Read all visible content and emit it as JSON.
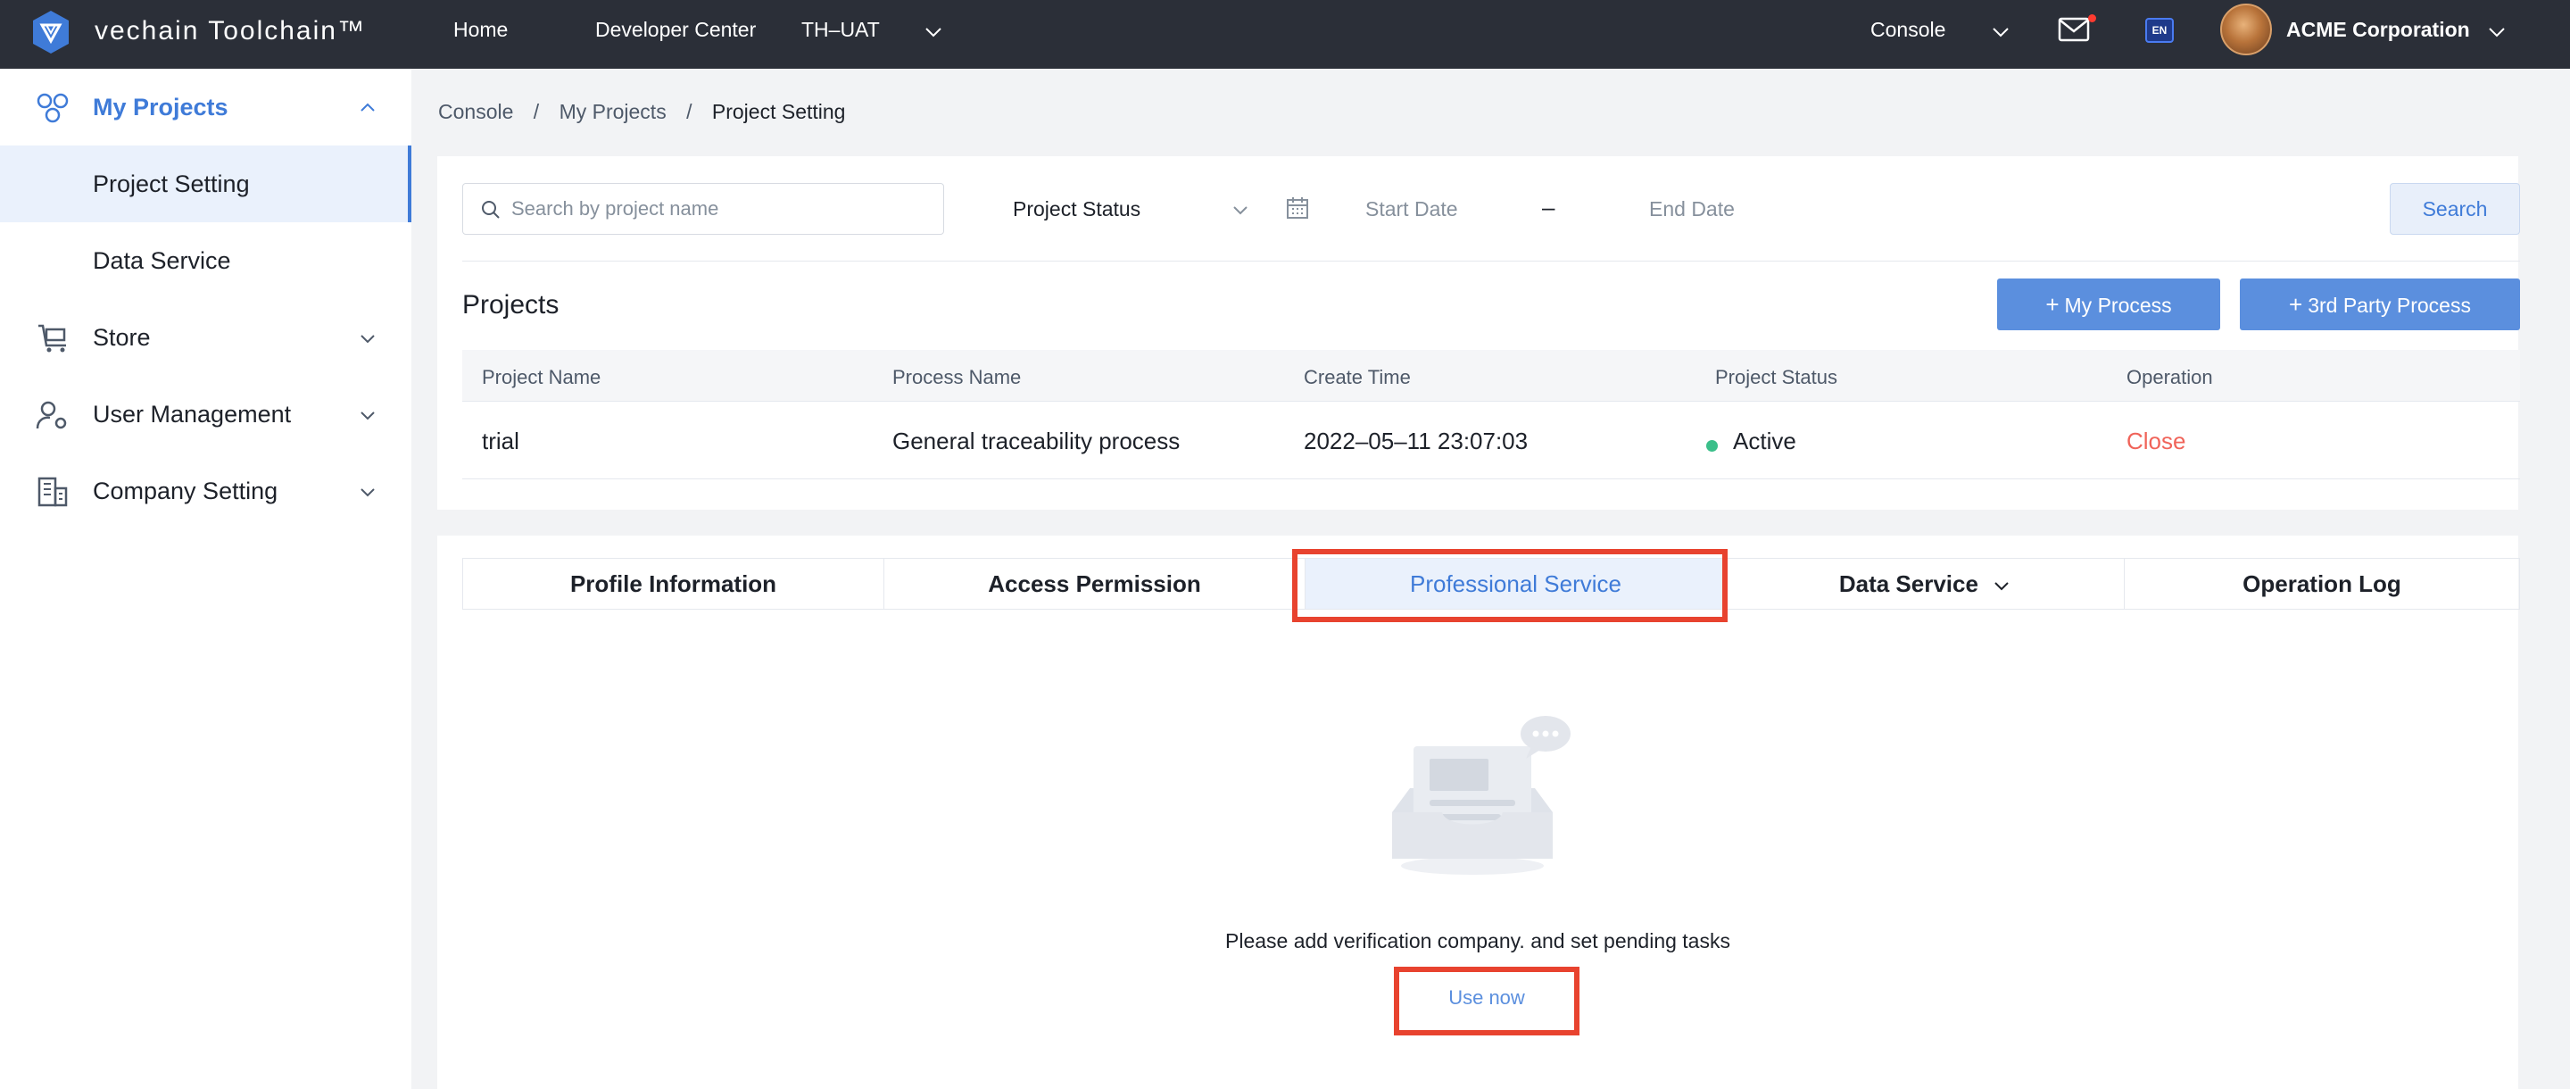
{
  "topbar": {
    "logo_text": "vechain Toolchain™",
    "nav": [
      "Home",
      "Developer Center",
      "TH–UAT"
    ],
    "console_label": "Console",
    "lang_label": "EN",
    "company_name": "ACME Corporation"
  },
  "sidebar": {
    "my_projects": "My Projects",
    "project_setting": "Project Setting",
    "data_service": "Data Service",
    "store": "Store",
    "user_management": "User Management",
    "company_setting": "Company Setting"
  },
  "breadcrumb": {
    "items": [
      "Console",
      "My Projects",
      "Project Setting"
    ]
  },
  "filters": {
    "search_placeholder": "Search by project name",
    "status_label": "Project Status",
    "start_date": "Start Date",
    "date_separator": "–",
    "end_date": "End Date",
    "search_button": "Search"
  },
  "projects": {
    "title": "Projects",
    "my_process_button": "My Process",
    "third_party_button": "3rd Party Process",
    "columns": [
      "Project Name",
      "Process Name",
      "Create Time",
      "Project Status",
      "Operation"
    ],
    "rows": [
      {
        "project_name": "trial",
        "process_name": "General traceability process",
        "create_time": "2022–05–11 23:07:03",
        "status": "Active",
        "operation": "Close"
      }
    ]
  },
  "detail": {
    "tabs": [
      "Profile Information",
      "Access Permission",
      "Professional Service",
      "Data Service",
      "Operation Log"
    ],
    "active_tab": "Professional Service",
    "empty_message": "Please add verification company. and set pending tasks",
    "use_now": "Use now"
  },
  "colors": {
    "topbar_bg": "#2b2f38",
    "accent": "#3f7bd8",
    "primary_button": "#5b8fde",
    "active_status": "#3bbf8a",
    "danger": "#f0645a",
    "highlight_box": "#e8432f"
  }
}
